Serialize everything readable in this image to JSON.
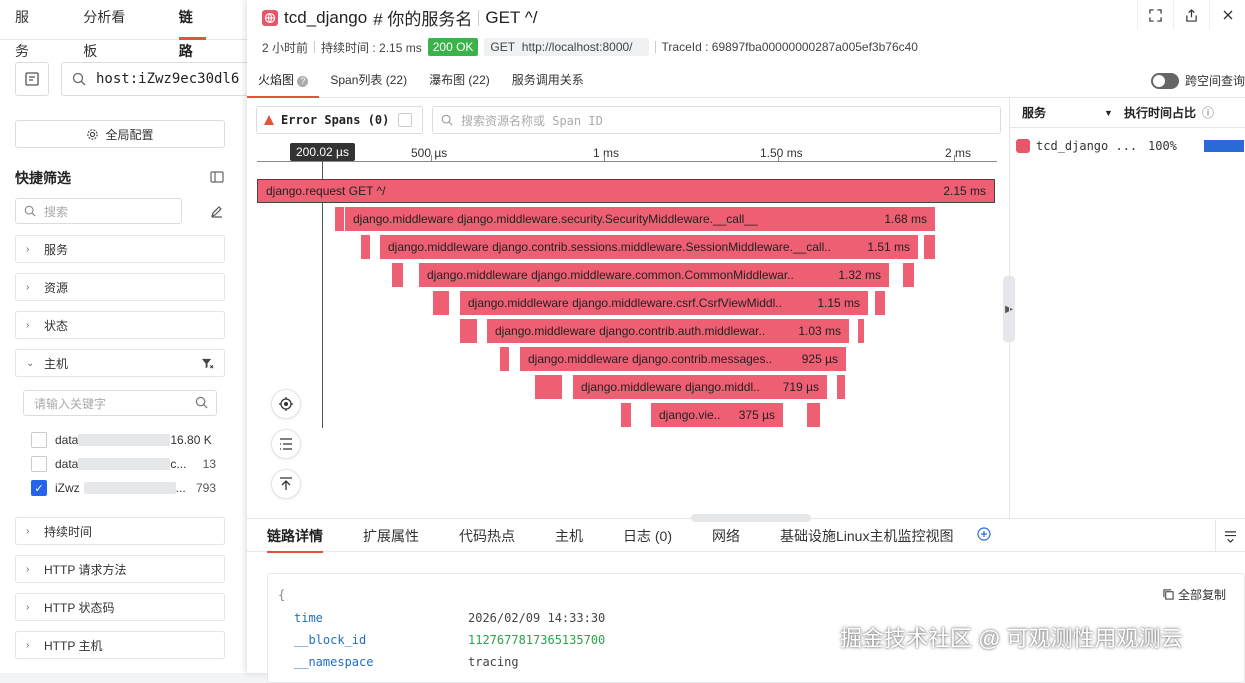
{
  "nav": {
    "items": [
      "服务",
      "分析看板",
      "链路"
    ],
    "active": 2
  },
  "query": {
    "text": "host:iZwz9ec30dl6"
  },
  "global_config": "全局配置",
  "quick_filter": {
    "title": "快捷筛选",
    "search_placeholder": "搜索",
    "facets": {
      "service": "服务",
      "resource": "资源",
      "status": "状态",
      "host": "主机",
      "duration": "持续时间",
      "http_method": "HTTP 请求方法",
      "http_status": "HTTP 状态码",
      "http_host": "HTTP 主机"
    },
    "host_keyword_placeholder": "请输入关键字",
    "host_rows": [
      {
        "prefix": "data",
        "suffix": "16.80 K",
        "count": "",
        "checked": false
      },
      {
        "prefix": "data",
        "suffix": "c...",
        "count": "13",
        "checked": false
      },
      {
        "prefix": "iZwz",
        "suffix": "...",
        "count": "793",
        "checked": true
      }
    ]
  },
  "drawer": {
    "title_service": "tcd_django",
    "title_rest": "# 你的服务名",
    "title_resource": "GET ^/",
    "meta": {
      "ago": "2 小时前",
      "duration": "持续时间 : 2.15 ms",
      "status": "200 OK",
      "method": "GET",
      "url": "http://localhost:8000/",
      "trace_id": "TraceId : 69897fba00000000287a005ef3b76c40"
    },
    "tabs": [
      "火焰图",
      "Span列表 (22)",
      "瀑布图 (22)",
      "服务调用关系"
    ],
    "cross_space": "跨空间查询",
    "error_spans": "Error Spans (0)",
    "span_search_placeholder": "搜索资源名称或 Span ID",
    "ruler": {
      "cursor": "200.02 µs",
      "ticks": [
        "500 µs",
        "1 ms",
        "1.50 ms",
        "2 ms"
      ]
    },
    "flame": [
      {
        "name": "django.request GET ^/",
        "dur": "2.15 ms"
      },
      {
        "name": "django.middleware django.middleware.security.SecurityMiddleware.__call__",
        "dur": "1.68 ms"
      },
      {
        "name": "django.middleware django.contrib.sessions.middleware.SessionMiddleware.__call..",
        "dur": "1.51 ms"
      },
      {
        "name": "django.middleware django.middleware.common.CommonMiddlewar..",
        "dur": "1.32 ms"
      },
      {
        "name": "django.middleware django.middleware.csrf.CsrfViewMiddl..",
        "dur": "1.15 ms"
      },
      {
        "name": "django.middleware django.contrib.auth.middlewar..",
        "dur": "1.03 ms"
      },
      {
        "name": "django.middleware django.contrib.messages..",
        "dur": "925 µs"
      },
      {
        "name": "django.middleware django.middl..",
        "dur": "719 µs"
      },
      {
        "name": "django.vie..",
        "dur": "375 µs"
      }
    ],
    "side_table": {
      "col_service": "服务",
      "col_ratio": "执行时间占比",
      "rows": [
        {
          "service": "tcd_django ...",
          "ratio": "100%",
          "fill": 1.0
        }
      ]
    },
    "detail_tabs": [
      "链路详情",
      "扩展属性",
      "代码热点",
      "主机",
      "日志 (0)",
      "网络",
      "基础设施Linux主机监控视图"
    ],
    "copy_all": "全部复制",
    "json_lines": [
      {
        "key": "time",
        "value": "2026/02/09 14:33:30"
      },
      {
        "key": "__block_id",
        "value": "1127677817365135700"
      },
      {
        "key": "__namespace",
        "value": "tracing"
      }
    ],
    "brace": "{"
  },
  "watermark": "掘金技术社区 @ 可观测性用观测云",
  "colors": {
    "accent": "#e2553c",
    "flame": "#ee5f73",
    "ok": "#3cb34a",
    "check": "#2563eb"
  }
}
